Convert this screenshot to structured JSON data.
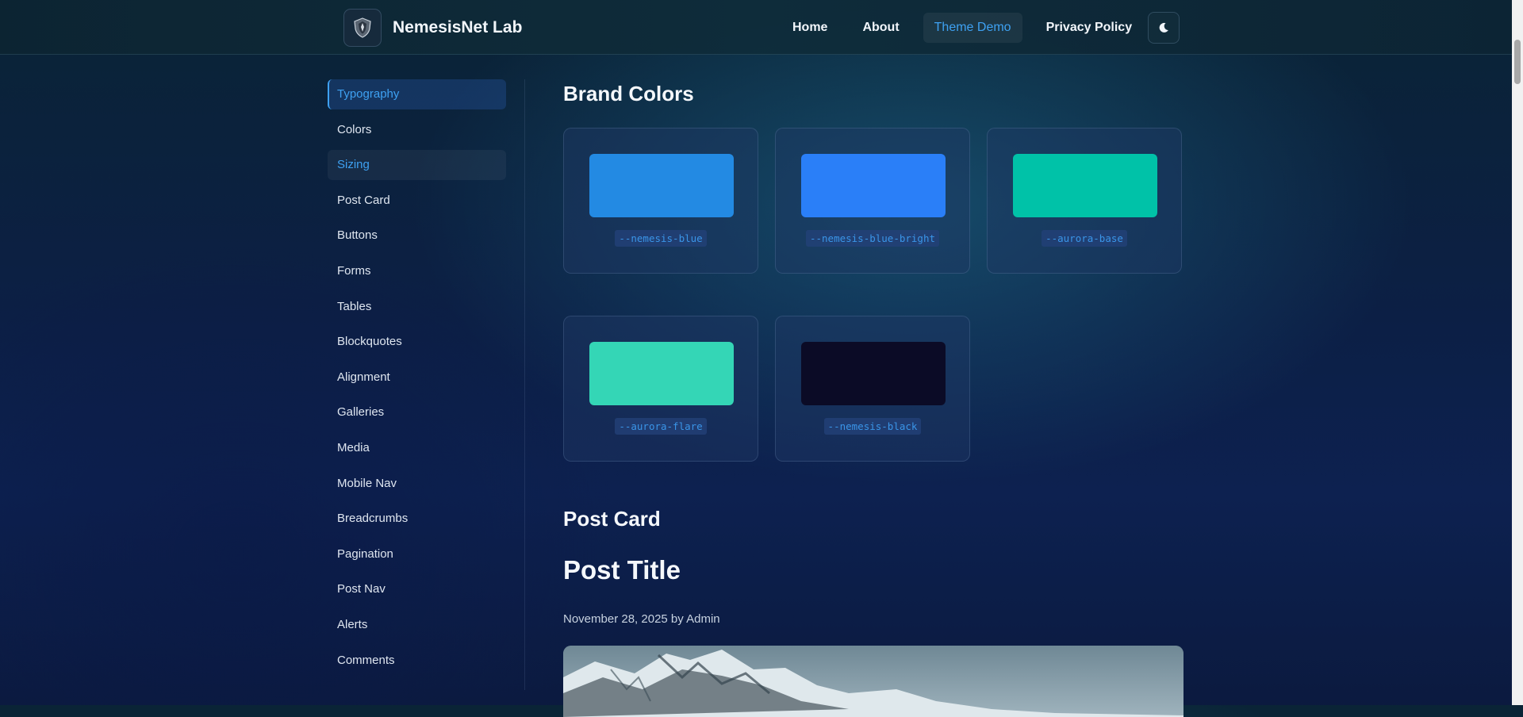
{
  "header": {
    "site_title": "NemesisNet Lab",
    "logo_icon": "shield-logo-icon",
    "nav": [
      {
        "label": "Home",
        "active": false
      },
      {
        "label": "About",
        "active": false
      },
      {
        "label": "Theme Demo",
        "active": true
      },
      {
        "label": "Privacy Policy",
        "active": false
      }
    ],
    "theme_toggle_icon": "moon-icon"
  },
  "sidebar": {
    "items": [
      {
        "label": "Typography",
        "state": "active"
      },
      {
        "label": "Colors",
        "state": ""
      },
      {
        "label": "Sizing",
        "state": "hover"
      },
      {
        "label": "Post Card",
        "state": ""
      },
      {
        "label": "Buttons",
        "state": ""
      },
      {
        "label": "Forms",
        "state": ""
      },
      {
        "label": "Tables",
        "state": ""
      },
      {
        "label": "Blockquotes",
        "state": ""
      },
      {
        "label": "Alignment",
        "state": ""
      },
      {
        "label": "Galleries",
        "state": ""
      },
      {
        "label": "Media",
        "state": ""
      },
      {
        "label": "Mobile Nav",
        "state": ""
      },
      {
        "label": "Breadcrumbs",
        "state": ""
      },
      {
        "label": "Pagination",
        "state": ""
      },
      {
        "label": "Post Nav",
        "state": ""
      },
      {
        "label": "Alerts",
        "state": ""
      },
      {
        "label": "Comments",
        "state": ""
      }
    ]
  },
  "main": {
    "brand_colors": {
      "heading": "Brand Colors",
      "swatches": [
        {
          "name": "--nemesis-blue",
          "color": "#238ae3"
        },
        {
          "name": "--nemesis-blue-bright",
          "color": "#2a7ff8"
        },
        {
          "name": "--aurora-base",
          "color": "#00c2a8"
        },
        {
          "name": "--aurora-flare",
          "color": "#34d6b6"
        },
        {
          "name": "--nemesis-black",
          "color": "#0b0b26"
        }
      ]
    },
    "post_card": {
      "heading": "Post Card",
      "post_title": "Post Title",
      "meta": "November 28, 2025 by Admin"
    }
  }
}
